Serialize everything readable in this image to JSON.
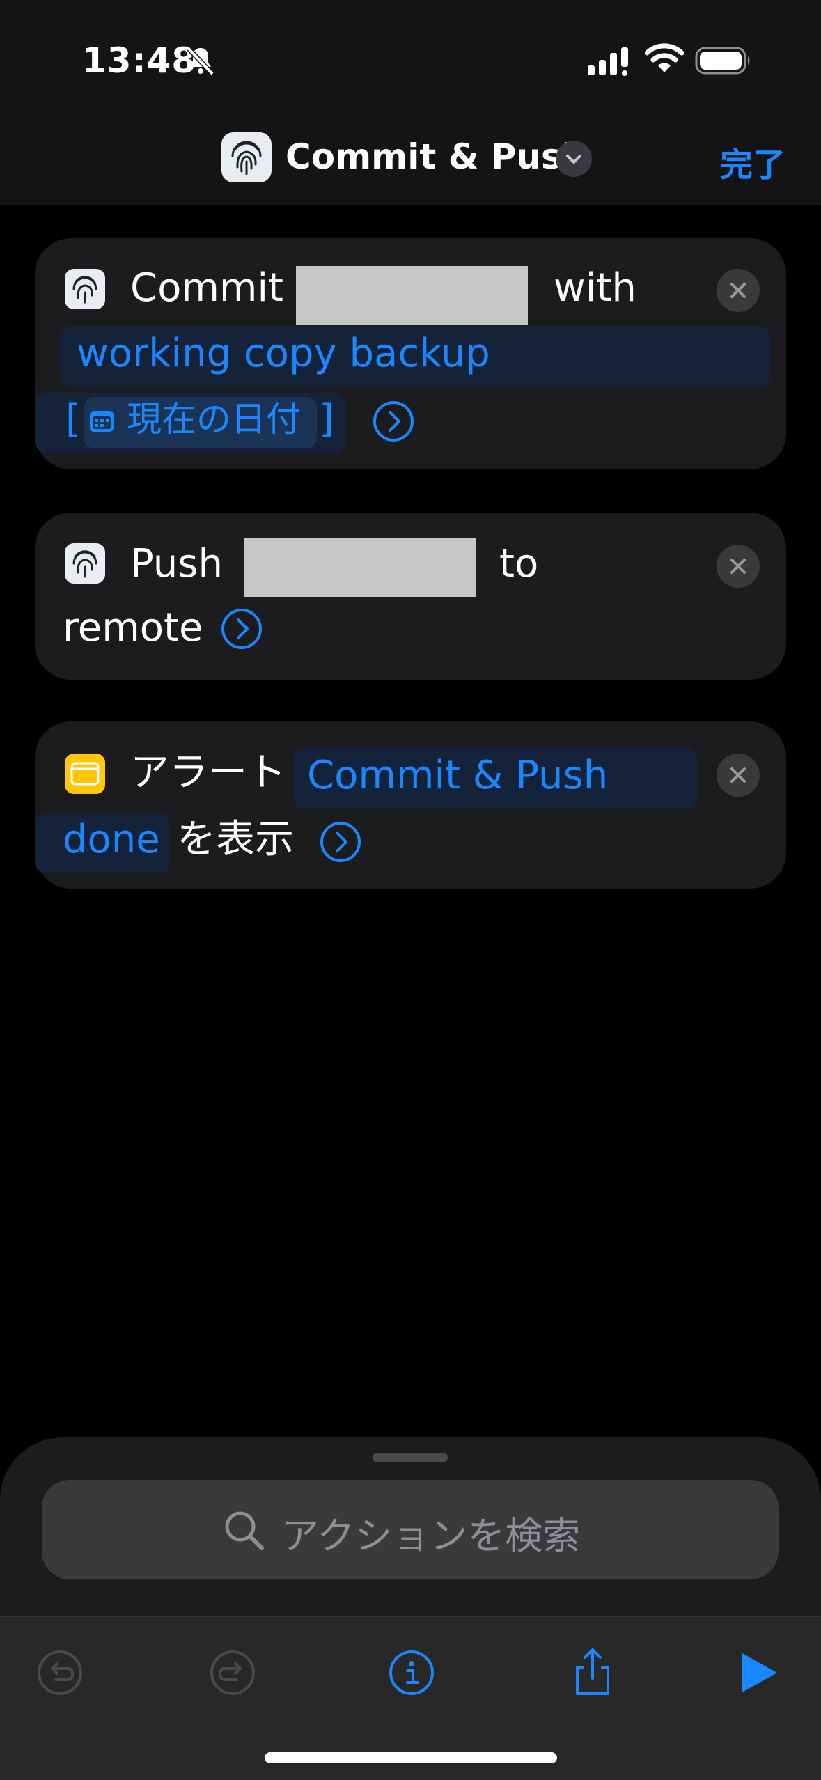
{
  "status_bar": {
    "time": "13:48"
  },
  "nav": {
    "title": "Commit & Push",
    "done_label": "完了"
  },
  "actions": [
    {
      "word1": "Commit",
      "word2": "with",
      "message": "working copy backup",
      "date_open": "[",
      "date_token": "現在の日付",
      "date_close": "]"
    },
    {
      "word1": "Push",
      "word2": "to",
      "word3": "remote"
    },
    {
      "word1": "アラート",
      "text_part1": "Commit & Push",
      "text_part2": "done",
      "word2": "を表示"
    }
  ],
  "search": {
    "placeholder": "アクションを検索"
  },
  "colors": {
    "accent": "#1a87ff",
    "alert_icon": "#ffc60a",
    "background": "#000000",
    "card": "#1c1c1e"
  },
  "icons": [
    "muted-bell-icon",
    "signal-icon",
    "wifi-icon",
    "battery-icon",
    "fingerprint-icon",
    "chevron-down-icon",
    "close-icon",
    "chevron-right-circle-icon",
    "calendar-icon",
    "alert-window-icon",
    "search-icon",
    "undo-icon",
    "redo-icon",
    "info-icon",
    "share-icon",
    "play-icon"
  ]
}
